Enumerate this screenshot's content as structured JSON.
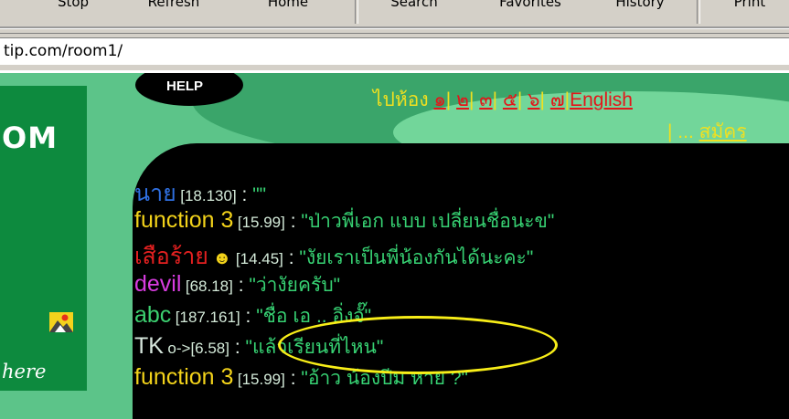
{
  "toolbar": {
    "stop": "Stop",
    "refresh": "Refresh",
    "home": "Home",
    "search": "Search",
    "favorites": "Favorites",
    "history": "History",
    "print": "Print"
  },
  "address": {
    "url": "tip.com/room1/"
  },
  "sidebar": {
    "logo": "OM",
    "here": "here"
  },
  "nav": {
    "help": "HELP",
    "go_room": "ไปห้อง",
    "rooms": [
      "๑",
      "๒",
      "๓",
      "๕",
      "๖",
      "๗"
    ],
    "english": "English",
    "ellipsis": "| ... ",
    "register": "สมัคร"
  },
  "chat": [
    {
      "name": "นาย",
      "name_color": "#2f6fe0",
      "ip": "[18.130]",
      "sep": " : ",
      "text": "\"\""
    },
    {
      "name": "function 3",
      "name_color": "#f2d21a",
      "ip": "[15.99]",
      "sep": " : ",
      "text": "\"ป่าวพี่เอก แบบ เปลี่ยนชื่อนะข\""
    },
    {
      "name": "เสือร้าย",
      "name_color": "#e42020",
      "ip": "[14.45]",
      "sep": " : ",
      "text": "\"งัยเราเป็นพี่น้องกันได้นะคะ\""
    },
    {
      "name": "devil",
      "name_color": "#d83ce0",
      "ip": "[68.18]",
      "sep": " : ",
      "text": "\"ว่างัยครับ\""
    },
    {
      "name": "abc",
      "name_color": "#3cd070",
      "ip": "[187.161]",
      "sep": " : ",
      "text": "\"ชื่อ เอ .. อิ่งจั๊\""
    },
    {
      "name": "TK",
      "name_color": "#d6e6dc",
      "ip": "o->[6.58]",
      "sep": " : ",
      "text": "\"แล้วเรียนที่ไหน\""
    },
    {
      "name": "function 3",
      "name_color": "#f2d21a",
      "ip": "[15.99]",
      "sep": " : ",
      "text": "\"อ้าว น้องปีม หาย ?\""
    }
  ],
  "colors": {
    "highlight_circle": "#f8ee18",
    "page_bg": "#5cc489",
    "chat_bg": "#000000"
  }
}
